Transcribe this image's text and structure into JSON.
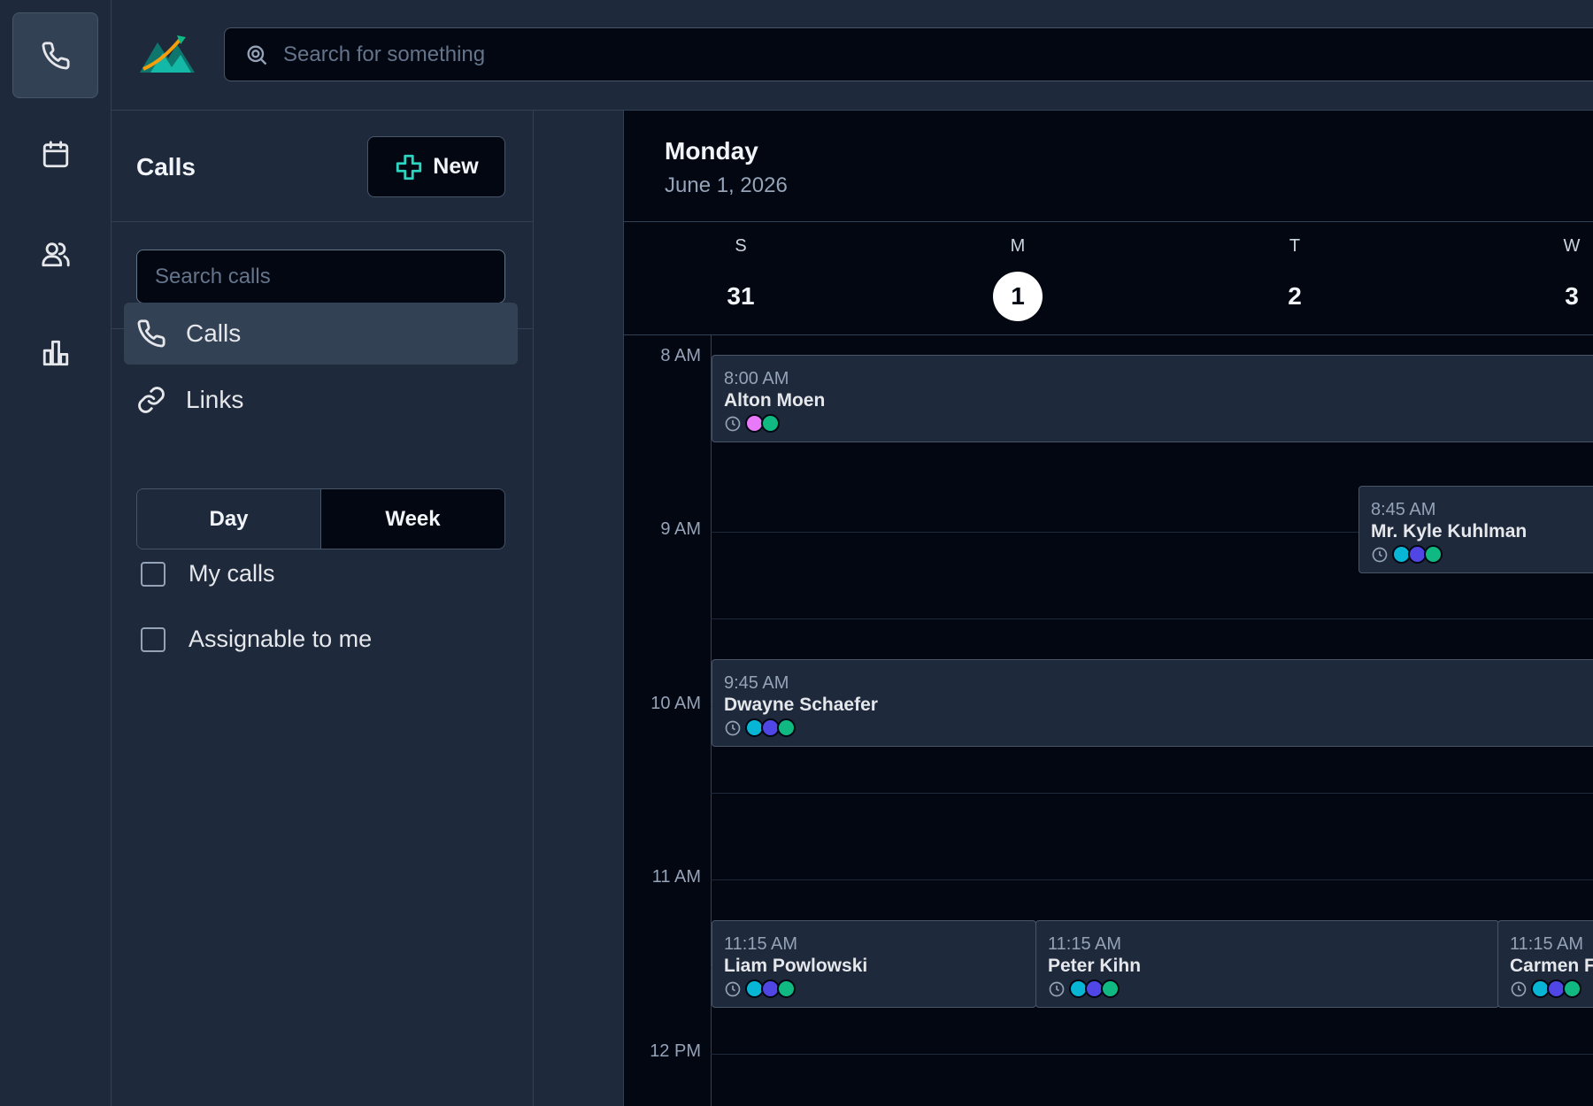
{
  "topbar": {
    "search_placeholder": "Search for something"
  },
  "panel": {
    "title": "Calls",
    "new_label": "New",
    "search_placeholder": "Search calls",
    "nav": [
      {
        "label": "Calls",
        "icon": "phone-icon",
        "active": true
      },
      {
        "label": "Links",
        "icon": "link-icon",
        "active": false
      }
    ],
    "view_toggle": {
      "day": "Day",
      "week": "Week",
      "selected": "Week"
    },
    "filters": [
      {
        "label": "My calls",
        "checked": false
      },
      {
        "label": "Assignable to me",
        "checked": false
      }
    ]
  },
  "calendar": {
    "day_name": "Monday",
    "date": "June 1, 2026",
    "week": [
      {
        "letter": "S",
        "num": "31"
      },
      {
        "letter": "M",
        "num": "1",
        "today": true
      },
      {
        "letter": "T",
        "num": "2"
      },
      {
        "letter": "W",
        "num": "3"
      }
    ],
    "hours": [
      "8 AM",
      "9 AM",
      "10 AM",
      "11 AM",
      "12 PM"
    ],
    "events": [
      {
        "time": "8:00 AM",
        "name": "Alton Moen",
        "colors": [
          "#e879f9",
          "#10b981"
        ]
      },
      {
        "time": "8:45 AM",
        "name": "Mr. Kyle Kuhlman",
        "colors": [
          "#06b6d4",
          "#4f46e5",
          "#10b981"
        ]
      },
      {
        "time": "9:45 AM",
        "name": "Dwayne Schaefer",
        "colors": [
          "#06b6d4",
          "#4f46e5",
          "#10b981"
        ]
      },
      {
        "time": "11:15 AM",
        "name": "Liam Powlowski",
        "colors": [
          "#06b6d4",
          "#4f46e5",
          "#10b981"
        ]
      },
      {
        "time": "11:15 AM",
        "name": "Peter Kihn",
        "colors": [
          "#06b6d4",
          "#4f46e5",
          "#10b981"
        ]
      },
      {
        "time": "11:15 AM",
        "name": "Carmen F",
        "colors": [
          "#06b6d4",
          "#4f46e5",
          "#10b981"
        ]
      }
    ]
  },
  "colors": {
    "accent": "#2dd4bf",
    "today_circle": "#ffffff",
    "background": "#030712",
    "panel": "#1e293b"
  }
}
